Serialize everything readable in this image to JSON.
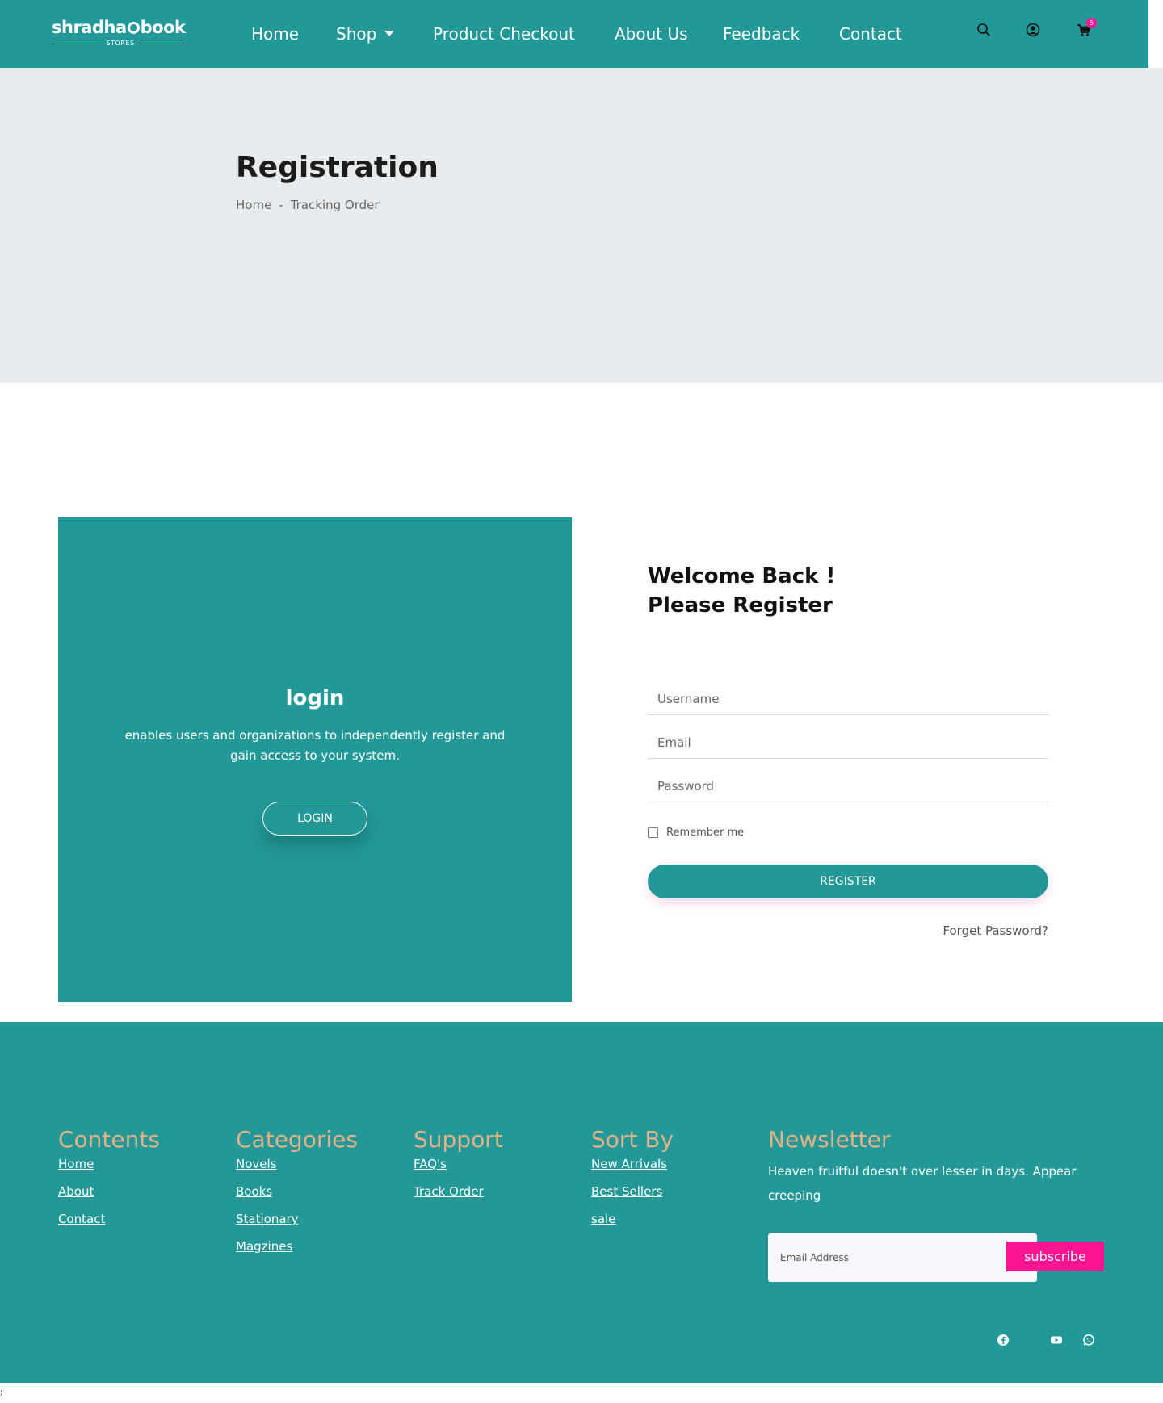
{
  "nav": {
    "logo_main_left": "shradha",
    "logo_main_right": "book",
    "logo_sub": "STORES",
    "links": [
      "Home",
      "Shop",
      "Product Checkout",
      "About Us",
      "Feedback",
      "Contact"
    ],
    "icons": [
      "search-icon",
      "user-icon",
      "cart-icon"
    ],
    "cart_count": "5"
  },
  "hero": {
    "title": "Registration",
    "breadcrumb_home": "Home",
    "breadcrumb_sep": "-",
    "breadcrumb_current": "Tracking Order"
  },
  "login_panel": {
    "title": "login",
    "description": "enables users and organizations to independently register and gain access to your system.",
    "button": "LOGIN"
  },
  "form": {
    "welcome_line1": "Welcome Back !",
    "welcome_line2": "Please Register",
    "username_placeholder": "Username",
    "email_placeholder": "Email",
    "password_placeholder": "Password",
    "remember_label": "Remember me",
    "register_button": "REGISTER",
    "forgot_link": "Forget Password?"
  },
  "footer": {
    "contents": {
      "title": "Contents",
      "links": [
        "Home",
        "About",
        "Contact"
      ]
    },
    "categories": {
      "title": "Categories",
      "links": [
        "Novels",
        "Books",
        "Stationary",
        "Magzines"
      ]
    },
    "support": {
      "title": "Support",
      "links": [
        "FAQ's",
        "Track Order"
      ]
    },
    "sort_by": {
      "title": "Sort By",
      "links": [
        "New Arrivals",
        "Best Sellers",
        "sale"
      ]
    },
    "newsletter": {
      "title": "Newsletter",
      "text": "Heaven fruitful doesn't over lesser in days. Appear creeping",
      "email_placeholder": "Email Address",
      "button": "subscribe"
    },
    "social_icons": [
      "facebook-icon",
      "youtube-icon",
      "whatsapp-icon"
    ]
  },
  "stray_text": ";",
  "colors": {
    "primary": "#239898",
    "accent": "#ff1493",
    "footer_heading": "#e2b184",
    "hero_bg": "#e8ebee"
  }
}
